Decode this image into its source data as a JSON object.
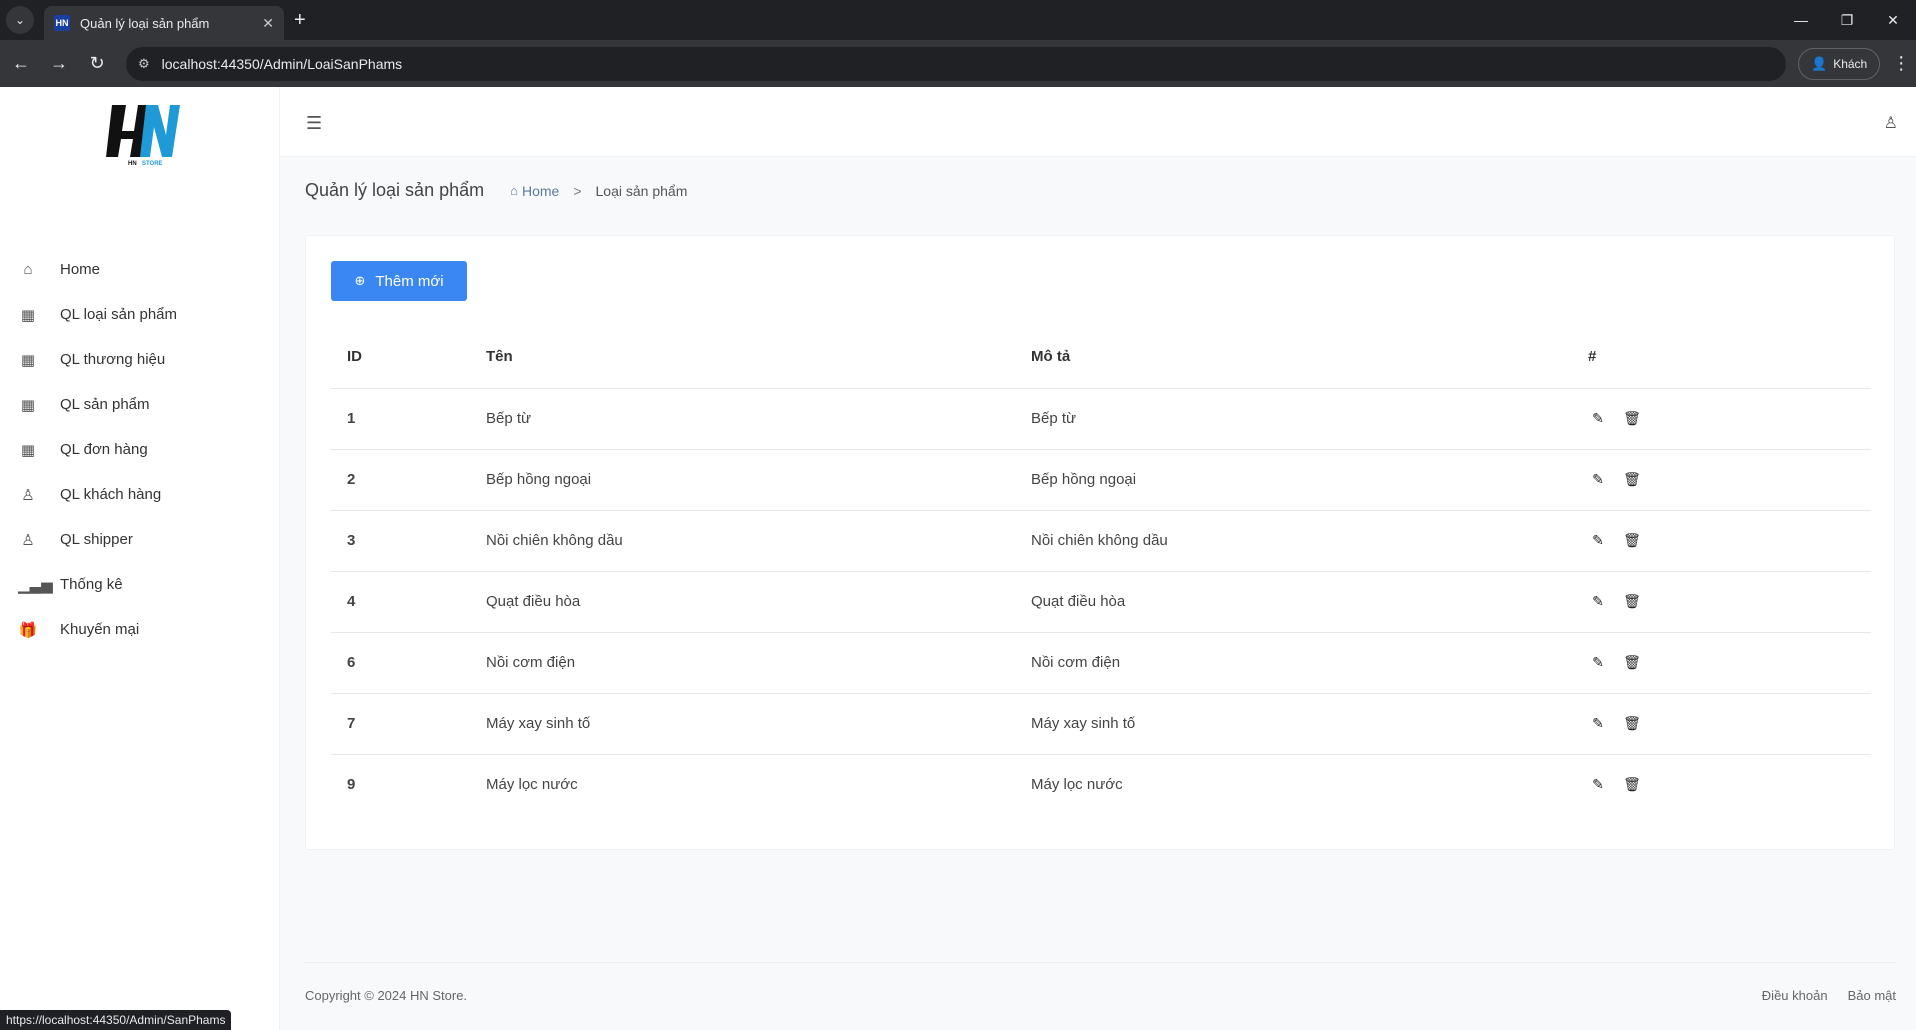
{
  "browser": {
    "tab_title": "Quản lý loại sản phẩm",
    "tab_favicon_text": "HN",
    "url": "localhost:44350/Admin/LoaiSanPhams",
    "profile_label": "Khách",
    "status_url": "https://localhost:44350/Admin/SanPhams"
  },
  "sidebar": {
    "logo_text": "HN STORE",
    "items": [
      {
        "label": "Home",
        "icon": "home-icon"
      },
      {
        "label": "QL loại sản phẩm",
        "icon": "grid-icon"
      },
      {
        "label": "QL thương hiệu",
        "icon": "grid-icon"
      },
      {
        "label": "QL sản phẩm",
        "icon": "grid-icon"
      },
      {
        "label": "QL đơn hàng",
        "icon": "grid-icon"
      },
      {
        "label": "QL khách hàng",
        "icon": "user-icon"
      },
      {
        "label": "QL shipper",
        "icon": "user-icon"
      },
      {
        "label": "Thống kê",
        "icon": "chart-icon"
      },
      {
        "label": "Khuyến mại",
        "icon": "gift-icon"
      }
    ]
  },
  "page": {
    "title": "Quản lý loại sản phẩm",
    "breadcrumb_home": "Home",
    "breadcrumb_sep": ">",
    "breadcrumb_current": "Loại sản phẩm",
    "add_button": "Thêm mới"
  },
  "table": {
    "headers": {
      "id": "ID",
      "name": "Tên",
      "desc": "Mô tả",
      "actions": "#"
    },
    "rows": [
      {
        "id": "1",
        "name": "Bếp từ",
        "desc": "Bếp từ"
      },
      {
        "id": "2",
        "name": "Bếp hồng ngoại",
        "desc": "Bếp hồng ngoại"
      },
      {
        "id": "3",
        "name": "Nồi chiên không dầu",
        "desc": "Nồi chiên không dầu"
      },
      {
        "id": "4",
        "name": "Quạt điều hòa",
        "desc": "Quạt điều hòa"
      },
      {
        "id": "6",
        "name": "Nồi cơm điện",
        "desc": "Nồi cơm điện"
      },
      {
        "id": "7",
        "name": "Máy xay sinh tố",
        "desc": "Máy xay sinh tố"
      },
      {
        "id": "9",
        "name": "Máy lọc nước",
        "desc": "Máy lọc nước"
      }
    ]
  },
  "footer": {
    "copyright": "Copyright © 2024 HN Store.",
    "terms": "Điều khoản",
    "privacy": "Bảo mật"
  },
  "colors": {
    "primary": "#3a86f3",
    "chrome_dark": "#202124"
  }
}
